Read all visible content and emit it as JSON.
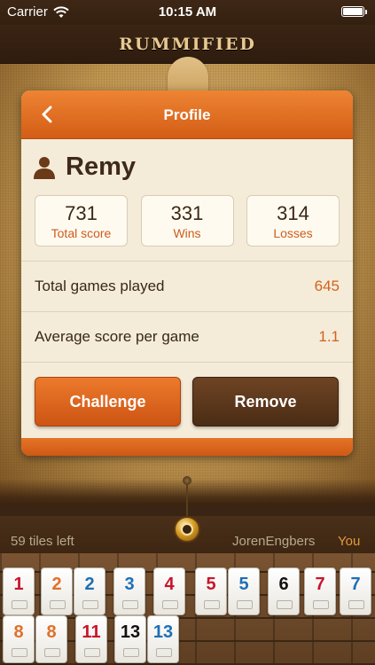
{
  "status_bar": {
    "carrier": "Carrier",
    "time": "10:15 AM",
    "battery_level": 1.0
  },
  "brand": {
    "title": "RUMMIFIED"
  },
  "profile": {
    "title": "Profile",
    "player_name": "Remy",
    "stats": [
      {
        "value": "731",
        "label": "Total score"
      },
      {
        "value": "331",
        "label": "Wins"
      },
      {
        "value": "314",
        "label": "Losses"
      }
    ],
    "rows": [
      {
        "label": "Total games played",
        "value": "645"
      },
      {
        "label": "Average score per game",
        "value": "1.1"
      }
    ],
    "buttons": {
      "challenge": "Challenge",
      "remove": "Remove"
    }
  },
  "game_bar": {
    "tiles_left": "59 tiles left",
    "opponent": "JorenEngbers",
    "you": "You"
  },
  "colors": {
    "accent_orange": "#d35d16",
    "tile_red": "#c8152b",
    "tile_orange": "#e0702a",
    "tile_blue": "#1f6fb5",
    "tile_black": "#111111"
  },
  "tiles": [
    {
      "num": "1",
      "color": "#c8152b"
    },
    {
      "num": "2",
      "color": "#e0702a"
    },
    {
      "num": "2",
      "color": "#1f6fb5"
    },
    {
      "num": "3",
      "color": "#1f6fb5"
    },
    {
      "num": "4",
      "color": "#c8152b"
    },
    {
      "num": "5",
      "color": "#c8152b"
    },
    {
      "num": "5",
      "color": "#1f6fb5"
    },
    {
      "num": "6",
      "color": "#111111"
    },
    {
      "num": "7",
      "color": "#c8152b"
    },
    {
      "num": "7",
      "color": "#1f6fb5"
    },
    {
      "num": "8",
      "color": "#e0702a"
    },
    {
      "num": "8",
      "color": "#e0702a"
    },
    {
      "num": "11",
      "color": "#c8152b"
    },
    {
      "num": "13",
      "color": "#111111"
    },
    {
      "num": "13",
      "color": "#1f6fb5"
    }
  ]
}
